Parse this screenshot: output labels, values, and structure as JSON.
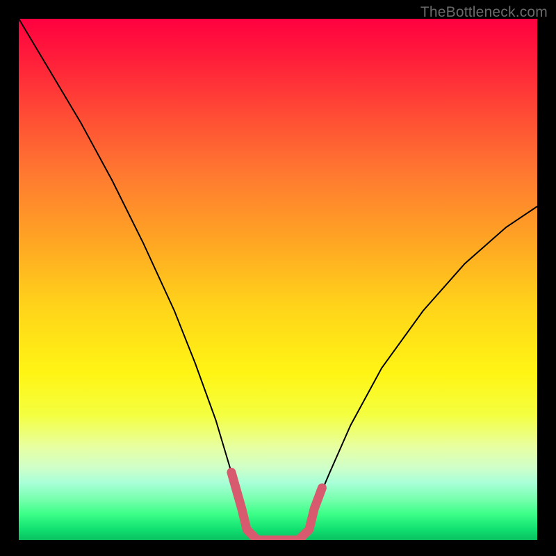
{
  "watermark": "TheBottleneck.com",
  "chart_data": {
    "type": "line",
    "title": "",
    "xlabel": "",
    "ylabel": "",
    "xlim": [
      0,
      100
    ],
    "ylim": [
      0,
      100
    ],
    "grid": false,
    "series": [
      {
        "name": "bottleneck-curve",
        "x": [
          0,
          6,
          12,
          18,
          24,
          30,
          34,
          38,
          41,
          43,
          44,
          46,
          50,
          54,
          56,
          57,
          60,
          64,
          70,
          78,
          86,
          94,
          100
        ],
        "y": [
          100,
          90,
          80,
          69,
          57,
          44,
          34,
          23,
          13,
          6,
          2,
          0,
          0,
          0,
          2,
          6,
          13,
          22,
          33,
          44,
          53,
          60,
          64
        ],
        "color": "#000000"
      },
      {
        "name": "bottleneck-floor-highlight",
        "x": [
          41,
          43,
          44,
          46,
          50,
          54,
          56,
          57,
          58.5
        ],
        "y": [
          13,
          6,
          2,
          0,
          0,
          0,
          2,
          6,
          10
        ],
        "color": "#d85a6e"
      }
    ],
    "gradient_stops": [
      {
        "pos": 0,
        "color": "#ff0040"
      },
      {
        "pos": 18,
        "color": "#ff4a35"
      },
      {
        "pos": 42,
        "color": "#ffa324"
      },
      {
        "pos": 68,
        "color": "#fff514"
      },
      {
        "pos": 86,
        "color": "#d0ffc8"
      },
      {
        "pos": 100,
        "color": "#0ac060"
      }
    ]
  }
}
